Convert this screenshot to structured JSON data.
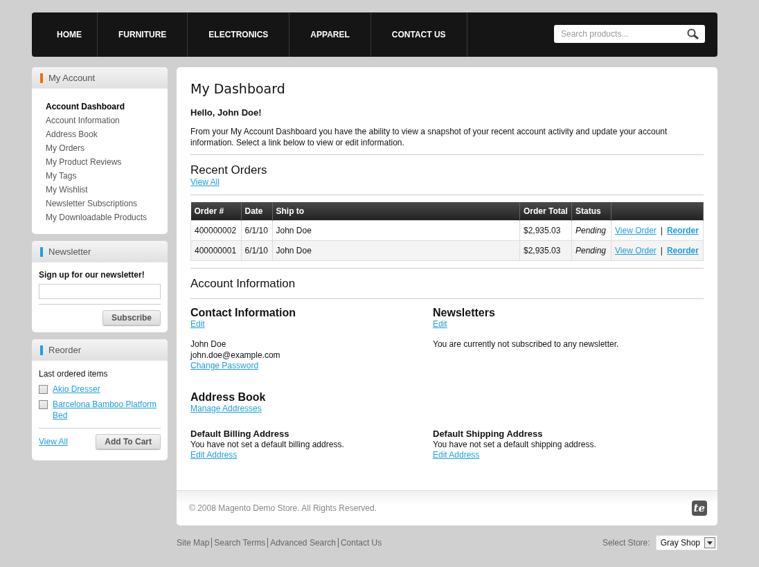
{
  "nav": {
    "items": [
      {
        "label": "HOME"
      },
      {
        "label": "FURNITURE"
      },
      {
        "label": "ELECTRONICS"
      },
      {
        "label": "APPAREL"
      },
      {
        "label": "CONTACT US"
      }
    ],
    "search": {
      "placeholder": "Search products..."
    }
  },
  "sidebar": {
    "account": {
      "title": "My Account",
      "items": [
        {
          "label": "Account Dashboard",
          "selected": true
        },
        {
          "label": "Account Information",
          "selected": false
        },
        {
          "label": "Address Book",
          "selected": false
        },
        {
          "label": "My Orders",
          "selected": false
        },
        {
          "label": "My Product Reviews",
          "selected": false
        },
        {
          "label": "My Tags",
          "selected": false
        },
        {
          "label": "My Wishlist",
          "selected": false
        },
        {
          "label": "Newsletter Subscriptions",
          "selected": false
        },
        {
          "label": "My Downloadable Products",
          "selected": false
        }
      ]
    },
    "newsletter": {
      "title": "Newsletter",
      "label": "Sign up for our newsletter!",
      "button": "Subscribe"
    },
    "reorder": {
      "title": "Reorder",
      "subtitle": "Last ordered items",
      "items": [
        {
          "label": "Akio Dresser",
          "checked": false
        },
        {
          "label": "Barcelona Bamboo Platform Bed",
          "checked": false
        }
      ],
      "view_all": "View All",
      "button": "Add To Cart"
    }
  },
  "main": {
    "title": "My Dashboard",
    "greeting": "Hello, John Doe!",
    "intro": "From your My Account Dashboard you have the ability to view a snapshot of your recent account activity and update your account information. Select a link below to view or edit information.",
    "recent_orders": {
      "title": "Recent Orders",
      "view_all": "View All",
      "columns": [
        "Order #",
        "Date",
        "Ship to",
        "Order Total",
        "Status"
      ],
      "rows": [
        {
          "cells": [
            "400000002",
            "6/1/10",
            "John Doe",
            "$2,935.03",
            "Pending"
          ],
          "view": "View Order",
          "separator": "|",
          "reorder": "Reorder"
        },
        {
          "cells": [
            "400000001",
            "6/1/10",
            "John Doe",
            "$2,935.03",
            "Pending"
          ],
          "view": "View Order",
          "separator": "|",
          "reorder": "Reorder"
        }
      ]
    },
    "account_info": {
      "title": "Account Information",
      "contact": {
        "title": "Contact Information",
        "edit": "Edit",
        "lines": [
          "John Doe",
          "john.doe@example.com"
        ],
        "link": "Change Password"
      },
      "newsletters": {
        "title": "Newsletters",
        "edit": "Edit",
        "text": "You are currently not subscribed to any newsletter."
      }
    },
    "address_book": {
      "title": "Address Book",
      "link": "Manage Addresses",
      "billing": {
        "title": "Default Billing Address",
        "text": "You have not set a default billing address.",
        "link": "Edit Address"
      },
      "shipping": {
        "title": "Default Shipping Address",
        "text": "You have not set a default shipping address.",
        "link": "Edit Address"
      }
    }
  },
  "footer": {
    "copyright": "© 2008 Magento Demo Store. All Rights Reserved.",
    "logo": "te",
    "links": [
      "Site Map",
      "Search Terms",
      "Advanced Search",
      "Contact Us"
    ],
    "store_label": "Select Store:",
    "store_value": "Gray Shop"
  }
}
